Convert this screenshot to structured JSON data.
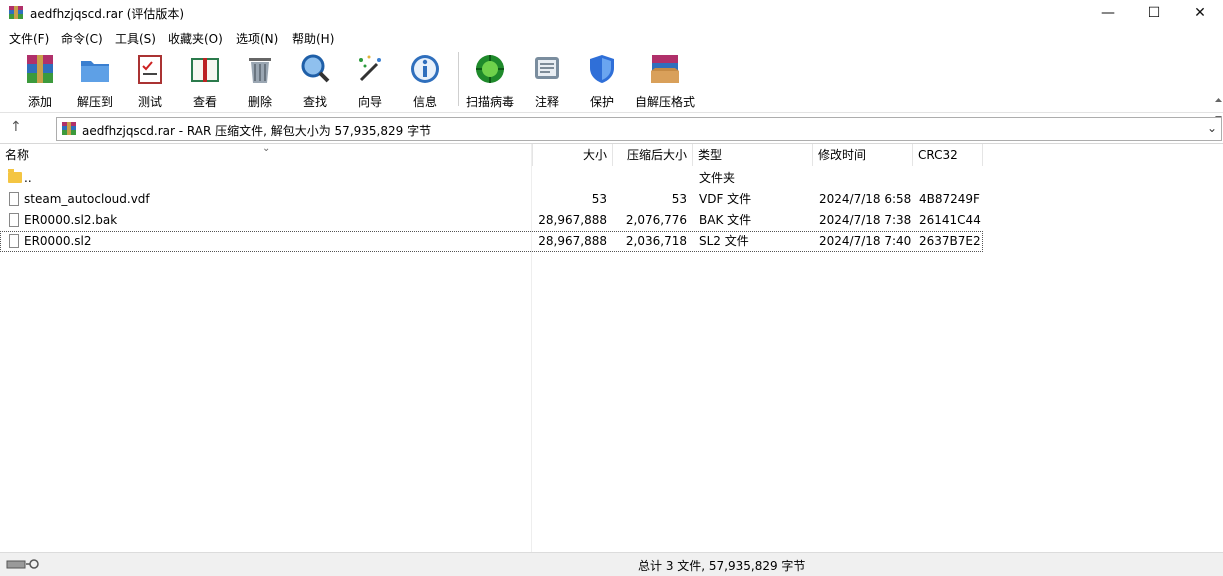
{
  "window": {
    "title": "aedfhzjqscd.rar (评估版本)",
    "minimize": "—",
    "maximize": "☐",
    "close": "✕"
  },
  "menu": [
    "文件(F)",
    "命令(C)",
    "工具(S)",
    "收藏夹(O)",
    "选项(N)",
    "帮助(H)"
  ],
  "toolbar": {
    "add": "添加",
    "extract": "解压到",
    "test": "测试",
    "view": "查看",
    "delete": "删除",
    "find": "查找",
    "wizard": "向导",
    "info": "信息",
    "virus": "扫描病毒",
    "comment": "注释",
    "protect": "保护",
    "sfx": "自解压格式"
  },
  "address": {
    "up": "↑",
    "text": "aedfhzjqscd.rar - RAR 压缩文件, 解包大小为 57,935,829 字节",
    "dropdown": "⌄"
  },
  "columns": {
    "name": "名称",
    "size": "大小",
    "packed": "压缩后大小",
    "type": "类型",
    "modified": "修改时间",
    "crc": "CRC32",
    "sort_indicator": "⌄"
  },
  "rows": [
    {
      "name": "..",
      "size": "",
      "packed": "",
      "type": "文件夹",
      "modified": "",
      "crc": ""
    },
    {
      "name": "steam_autocloud.vdf",
      "size": "53",
      "packed": "53",
      "type": "VDF 文件",
      "modified": "2024/7/18 6:58",
      "crc": "4B87249F"
    },
    {
      "name": "ER0000.sl2.bak",
      "size": "28,967,888",
      "packed": "2,076,776",
      "type": "BAK 文件",
      "modified": "2024/7/18 7:38",
      "crc": "26141C44"
    },
    {
      "name": "ER0000.sl2",
      "size": "28,967,888",
      "packed": "2,036,718",
      "type": "SL2 文件",
      "modified": "2024/7/18 7:40",
      "crc": "2637B7E2"
    }
  ],
  "status": {
    "text": "总计 3 文件, 57,935,829 字节"
  }
}
